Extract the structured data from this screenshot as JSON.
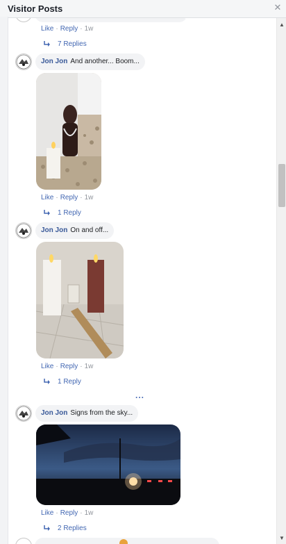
{
  "header": {
    "title": "Visitor Posts",
    "close_icon": "close-icon"
  },
  "top_partial": {
    "actions": {
      "like": "Like",
      "reply": "Reply",
      "time": "1w"
    },
    "replies_label": "7 Replies"
  },
  "comments": [
    {
      "author": "Jon Jon",
      "text": "And another... Boom...",
      "media": "photo of a carved figure statue with a lit white candle on gravel",
      "actions": {
        "like": "Like",
        "reply": "Reply",
        "time": "1w"
      },
      "replies_label": "1 Reply"
    },
    {
      "author": "Jon Jon",
      "text": "On and off...",
      "media": "photo of a white candle and a red candle on a tiled floor",
      "actions": {
        "like": "Like",
        "reply": "Reply",
        "time": "1w"
      },
      "replies_label": "1 Reply"
    },
    {
      "author": "Jon Jon",
      "text": "Signs from the sky...",
      "media": "photo of a dusk sky over a road with car lights",
      "actions": {
        "like": "Like",
        "reply": "Reply",
        "time": "1w"
      },
      "replies_label": "2 Replies"
    }
  ],
  "more_label": "...",
  "icons": {
    "reply_arrow": "reply-arrow-icon",
    "scroll_up": "scroll-up-arrow-icon",
    "scroll_down": "scroll-down-arrow-icon"
  },
  "colors": {
    "link": "#4267b2",
    "author": "#385898",
    "bubble": "#f2f3f5",
    "meta": "#90949c"
  }
}
